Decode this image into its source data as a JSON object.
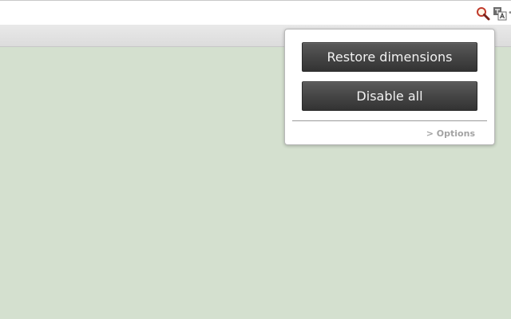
{
  "browser": {
    "extensions": [
      {
        "icon": "magnifier-icon",
        "color": "#c0392b"
      },
      {
        "icon": "translate-icon",
        "color": "#555555"
      }
    ]
  },
  "popup": {
    "restore_button_label": "Restore dimensions",
    "disable_button_label": "Disable all",
    "options_link_label": "> Options"
  },
  "colors": {
    "page_background": "#d4e0cf",
    "button_background": "#444444",
    "button_text": "#f2f2f2",
    "link_text": "#a3a3a3"
  }
}
